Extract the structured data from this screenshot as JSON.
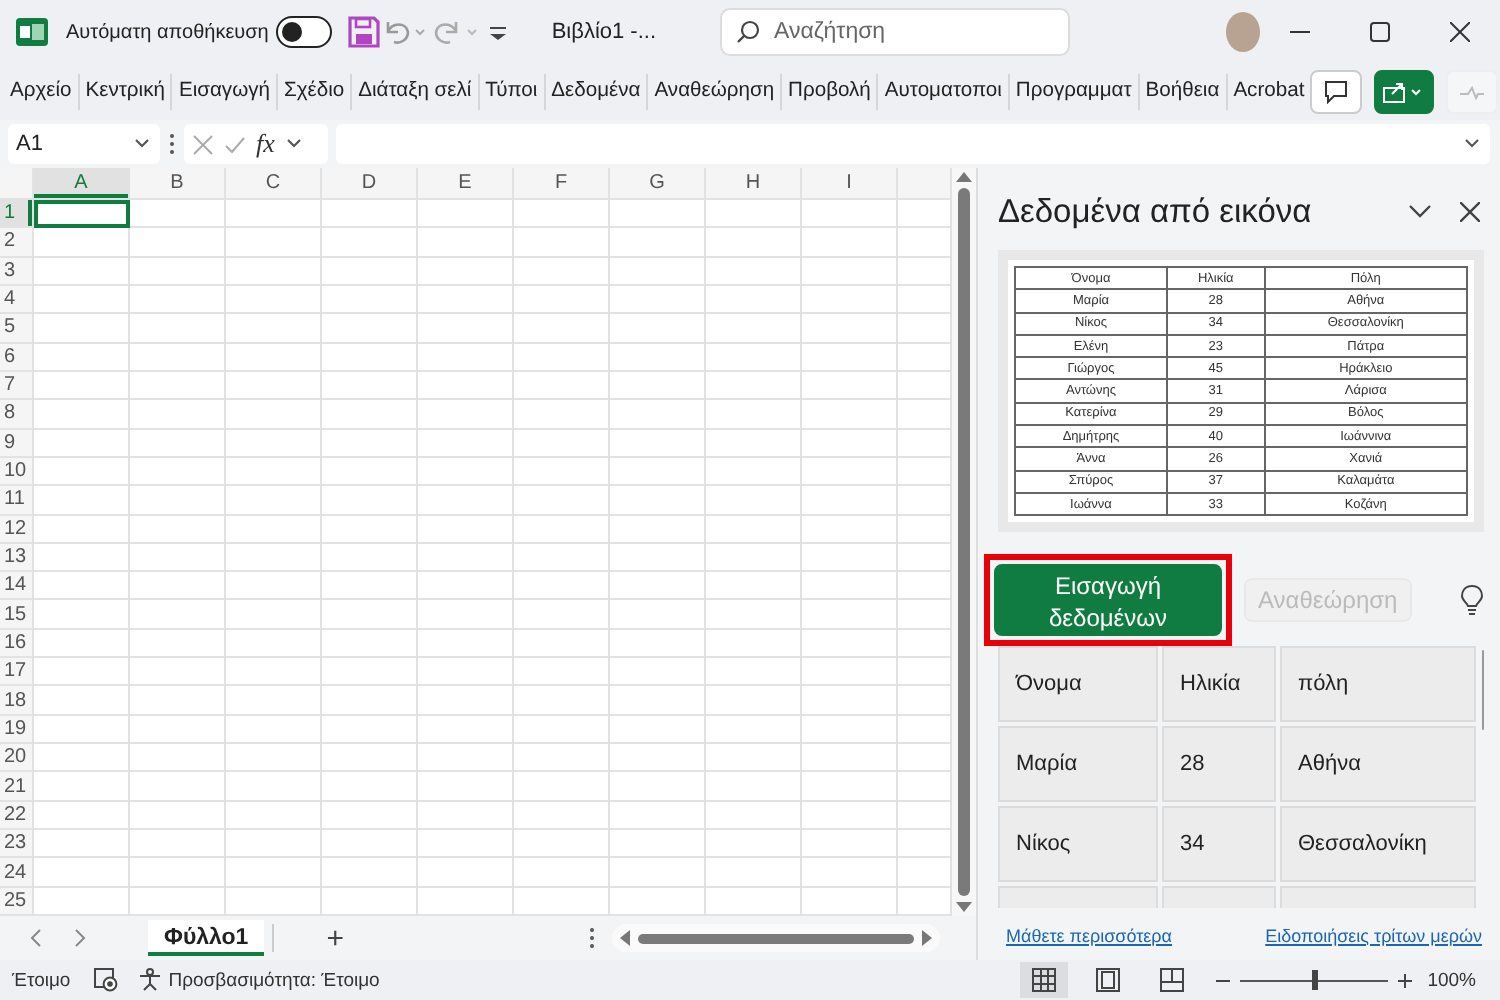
{
  "title_bar": {
    "autosave": {
      "label": "Αυτόματη αποθήκευση",
      "on": false
    },
    "title": "Βιβλίο1 -...",
    "search": {
      "placeholder": "Αναζήτηση"
    }
  },
  "ribbon_tabs": [
    {
      "label": "Αρχείο",
      "selected": false
    },
    {
      "label": "Κεντρική",
      "selected": false
    },
    {
      "label": "Εισαγωγή",
      "selected": false
    },
    {
      "label": "Σχέδιο",
      "selected": false
    },
    {
      "label": "Διάταξη σελί",
      "selected": false
    },
    {
      "label": "Τύποι",
      "selected": false
    },
    {
      "label": "Δεδομένα",
      "selected": false
    },
    {
      "label": "Αναθεώρηση",
      "selected": false
    },
    {
      "label": "Προβολή",
      "selected": false
    },
    {
      "label": "Αυτοματοποι",
      "selected": false
    },
    {
      "label": "Προγραμματ",
      "selected": false
    },
    {
      "label": "Βοήθεια",
      "selected": false
    },
    {
      "label": "Acrobat",
      "selected": false
    }
  ],
  "formula_bar": {
    "name_box": "A1",
    "function_label": "fx"
  },
  "sheet": {
    "columns": [
      {
        "label": "A",
        "selected": true
      },
      {
        "label": "B",
        "selected": false
      },
      {
        "label": "C",
        "selected": false
      },
      {
        "label": "D",
        "selected": false
      },
      {
        "label": "E",
        "selected": false
      },
      {
        "label": "F",
        "selected": false
      },
      {
        "label": "G",
        "selected": false
      },
      {
        "label": "H",
        "selected": false
      },
      {
        "label": "I",
        "selected": false
      }
    ],
    "rows": [
      {
        "label": "1",
        "selected": true
      },
      {
        "label": "2",
        "selected": false
      },
      {
        "label": "3",
        "selected": false
      },
      {
        "label": "4",
        "selected": false
      },
      {
        "label": "5",
        "selected": false
      },
      {
        "label": "6",
        "selected": false
      },
      {
        "label": "7",
        "selected": false
      },
      {
        "label": "8",
        "selected": false
      },
      {
        "label": "9",
        "selected": false
      },
      {
        "label": "10",
        "selected": false
      },
      {
        "label": "11",
        "selected": false
      },
      {
        "label": "12",
        "selected": false
      },
      {
        "label": "13",
        "selected": false
      },
      {
        "label": "14",
        "selected": false
      },
      {
        "label": "15",
        "selected": false
      },
      {
        "label": "16",
        "selected": false
      },
      {
        "label": "17",
        "selected": false
      },
      {
        "label": "18",
        "selected": false
      },
      {
        "label": "19",
        "selected": false
      },
      {
        "label": "20",
        "selected": false
      },
      {
        "label": "21",
        "selected": false
      },
      {
        "label": "22",
        "selected": false
      },
      {
        "label": "23",
        "selected": false
      },
      {
        "label": "24",
        "selected": false
      },
      {
        "label": "25",
        "selected": false
      }
    ]
  },
  "task_pane": {
    "title": "Δεδομένα από εικόνα",
    "source_table": {
      "columns": [
        "Όνομα",
        "Ηλικία",
        "Πόλη"
      ],
      "rows": [
        [
          "Μαρία",
          "28",
          "Αθήνα"
        ],
        [
          "Νίκος",
          "34",
          "Θεσσαλονίκη"
        ],
        [
          "Ελένη",
          "23",
          "Πάτρα"
        ],
        [
          "Γιώργος",
          "45",
          "Ηράκλειο"
        ],
        [
          "Αντώνης",
          "31",
          "Λάρισα"
        ],
        [
          "Κατερίνα",
          "29",
          "Βόλος"
        ],
        [
          "Δημήτρης",
          "40",
          "Ιωάννινα"
        ],
        [
          "Άννα",
          "26",
          "Χανιά"
        ],
        [
          "Σπύρος",
          "37",
          "Καλαμάτα"
        ],
        [
          "Ιωάννα",
          "33",
          "Κοζάνη"
        ]
      ]
    },
    "buttons": [
      {
        "label": "Εισαγωγή δεδομένων",
        "kind": "primary",
        "highlighted": true,
        "disabled": false
      },
      {
        "label": "Αναθεώρηση",
        "kind": "secondary",
        "highlighted": false,
        "disabled": true
      }
    ],
    "preview": {
      "columns": [
        "Όνομα",
        "Ηλικία",
        "πόλη"
      ],
      "rows": [
        [
          "Μαρία",
          "28",
          "Αθήνα"
        ],
        [
          "Νίκος",
          "34",
          "Θεσσαλονίκη"
        ]
      ]
    },
    "links": [
      "Μάθετε περισσότερα",
      "Ειδοποιήσεις τρίτων μερών"
    ]
  },
  "sheet_tabs": [
    {
      "label": "Φύλλο1",
      "selected": true
    }
  ],
  "add_sheet": "+",
  "status_bar": {
    "status": "Έτοιμο",
    "accessibility": "Προσβασιμότητα: Έτοιμο",
    "views": [
      {
        "kind": "normal",
        "selected": true
      },
      {
        "kind": "page_layout",
        "selected": false
      },
      {
        "kind": "page_break",
        "selected": false
      }
    ],
    "zoom": {
      "level": 0.5,
      "reading": "100%"
    }
  }
}
